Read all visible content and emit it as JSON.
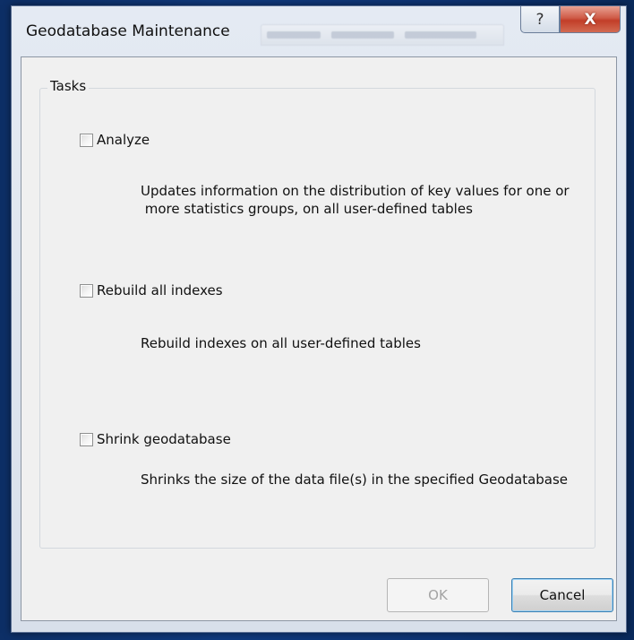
{
  "window": {
    "title": "Geodatabase Maintenance",
    "help_glyph": "?",
    "close_glyph": "X",
    "icons": [
      "help-icon",
      "close-icon"
    ]
  },
  "group": {
    "legend": "Tasks"
  },
  "tasks": [
    {
      "label": "Analyze",
      "checked": false,
      "description": "Updates information on the distribution of key values for one or\n more statistics groups, on all user-defined tables"
    },
    {
      "label": "Rebuild all indexes",
      "checked": false,
      "description": "Rebuild indexes on all user-defined tables"
    },
    {
      "label": "Shrink geodatabase",
      "checked": false,
      "description": "Shrinks the size of the data file(s) in the specified Geodatabase"
    }
  ],
  "buttons": {
    "ok_label": "OK",
    "ok_enabled": false,
    "cancel_label": "Cancel"
  },
  "colors": {
    "background": "#103a7e",
    "close_button": "#c23e28",
    "cancel_focus_border": "#3c7fb1"
  }
}
